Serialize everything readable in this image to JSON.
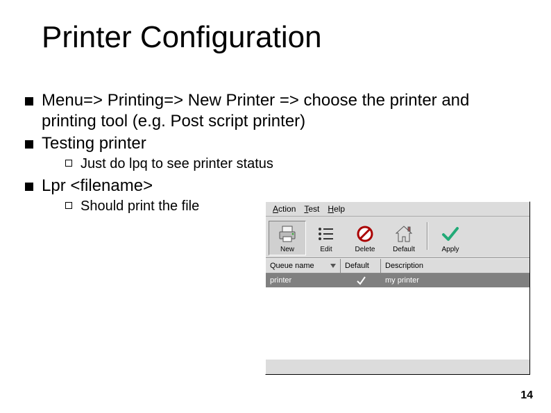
{
  "title": "Printer Configuration",
  "bullets": {
    "item1": "Menu=> Printing=> New Printer => choose the printer and printing tool (e.g. Post script printer)",
    "item2": "Testing printer",
    "item2_sub1": "Just do lpq to see printer status",
    "item3": "Lpr <filename>",
    "item3_sub1": "Should print the file"
  },
  "gui": {
    "menu": {
      "action_pre": "A",
      "action_rest": "ction",
      "test_pre": "T",
      "test_rest": "est",
      "help_pre": "H",
      "help_rest": "elp"
    },
    "toolbar": {
      "new": "New",
      "edit": "Edit",
      "delete": "Delete",
      "default": "Default",
      "apply": "Apply"
    },
    "table": {
      "headers": {
        "queue": "Queue name",
        "default": "Default",
        "desc": "Description"
      },
      "row1": {
        "queue": "printer",
        "desc": "my printer"
      }
    }
  },
  "page_number": "14"
}
